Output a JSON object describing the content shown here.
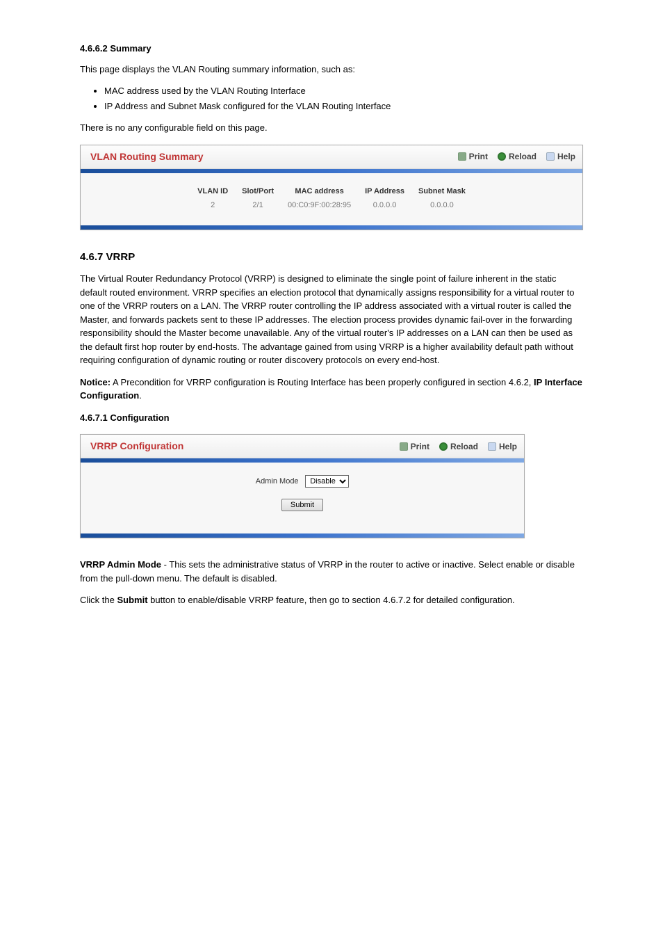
{
  "section1": {
    "heading": "4.6.6.2 Summary",
    "intro": "This page displays the VLAN Routing summary information, such as:",
    "bullets": [
      "MAC address used by the VLAN Routing Interface",
      "IP Address and Subnet Mask configured for the VLAN Routing Interface"
    ]
  },
  "noconfig": "There is no any configurable field on this page.",
  "screenshot1": {
    "title": "VLAN Routing Summary",
    "actions": {
      "print": "Print",
      "reload": "Reload",
      "help": "Help"
    },
    "table": {
      "headers": [
        "VLAN ID",
        "Slot/Port",
        "MAC address",
        "IP Address",
        "Subnet Mask"
      ],
      "row": [
        "2",
        "2/1",
        "00:C0:9F:00:28:95",
        "0.0.0.0",
        "0.0.0.0"
      ]
    }
  },
  "section2": {
    "heading": "4.6.7 VRRP",
    "para1": "The Virtual Router Redundancy Protocol (VRRP) is designed to eliminate the single point of failure inherent in the static default routed environment. VRRP specifies an election protocol that dynamically assigns responsibility for a virtual router to one of the VRRP routers on a LAN. The VRRP router controlling the IP address associated with a virtual router is called the Master, and forwards packets sent to these IP addresses. The election process provides dynamic fail-over in the forwarding responsibility should the Master become unavailable. Any of the virtual router's IP addresses on a LAN can then be used as the default first hop router by end-hosts. The advantage gained from using VRRP is a higher availability default path without requiring configuration of dynamic routing or router discovery protocols on every end-host.",
    "notice_lead": "Notice:",
    "notice_body": " A Precondition for VRRP configuration is Routing Interface has been properly configured in section 4.6.2, ",
    "notice_link": "IP Interface Configuration",
    "notice_tail": ".",
    "sub1": "4.6.7.1 Configuration"
  },
  "screenshot2": {
    "title": "VRRP Configuration",
    "actions": {
      "print": "Print",
      "reload": "Reload",
      "help": "Help"
    },
    "form": {
      "label": "Admin Mode",
      "selected": "Disable",
      "button": "Submit"
    }
  },
  "after": {
    "p1_lead": "VRRP Admin Mode ",
    "p1_body": "- This sets the administrative status of VRRP in the router to active or inactive. Select enable or disable from the pull-down menu. The default is disabled.",
    "p2_a": "Click the ",
    "p2_b": "Submit",
    "p2_c": " button to enable/disable VRRP feature, then go to section 4.6.7.2 for detailed configuration."
  }
}
